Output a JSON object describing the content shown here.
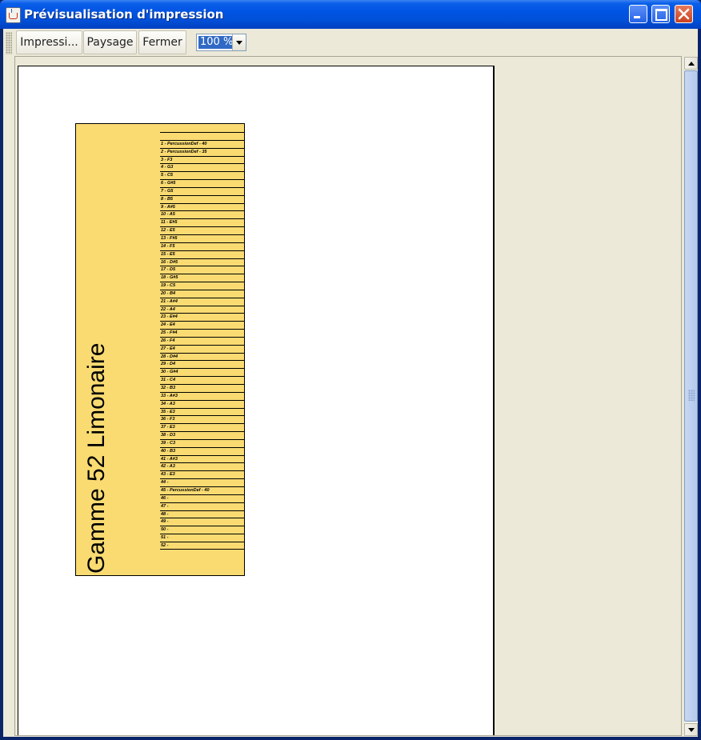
{
  "window": {
    "title": "Prévisualisation d'impression"
  },
  "toolbar": {
    "print_label": "Impressi...",
    "landscape_label": "Paysage",
    "close_label": "Fermer",
    "zoom_value": "100 %"
  },
  "preview": {
    "card_title": "Gamme 52 Limonaire",
    "card_color": "#f9db72",
    "rows": [
      "",
      "1 - PercussionDef - 40",
      "2 - PercussionDef - 35",
      "3 - F3",
      "4 - G3",
      "5 - C5",
      "6 - G#5",
      "7 - G5",
      "8 - B5",
      "9 - A#5",
      "10 - A5",
      "11 - E#5",
      "12 - E5",
      "13 - F#5",
      "14 - F5",
      "15 - E5",
      "16 - D#5",
      "17 - D5",
      "18 - G#5",
      "19 - C5",
      "20 - B4",
      "21 - A#4",
      "22 - A4",
      "23 - E#4",
      "24 - E4",
      "25 - F#4",
      "26 - F4",
      "27 - E4",
      "28 - D#4",
      "29 - D4",
      "30 - G#4",
      "31 - C4",
      "32 - B3",
      "33 - A#3",
      "34 - A3",
      "35 - E3",
      "36 - F3",
      "37 - E3",
      "38 - D3",
      "39 - C3",
      "40 - B3",
      "41 - A#3",
      "42 - A3",
      "43 - E3",
      "44 -",
      "45 - PercussionDef - 40",
      "46 -",
      "47 -",
      "48 -",
      "49 -",
      "50 -",
      "51 -",
      "52 -"
    ]
  }
}
